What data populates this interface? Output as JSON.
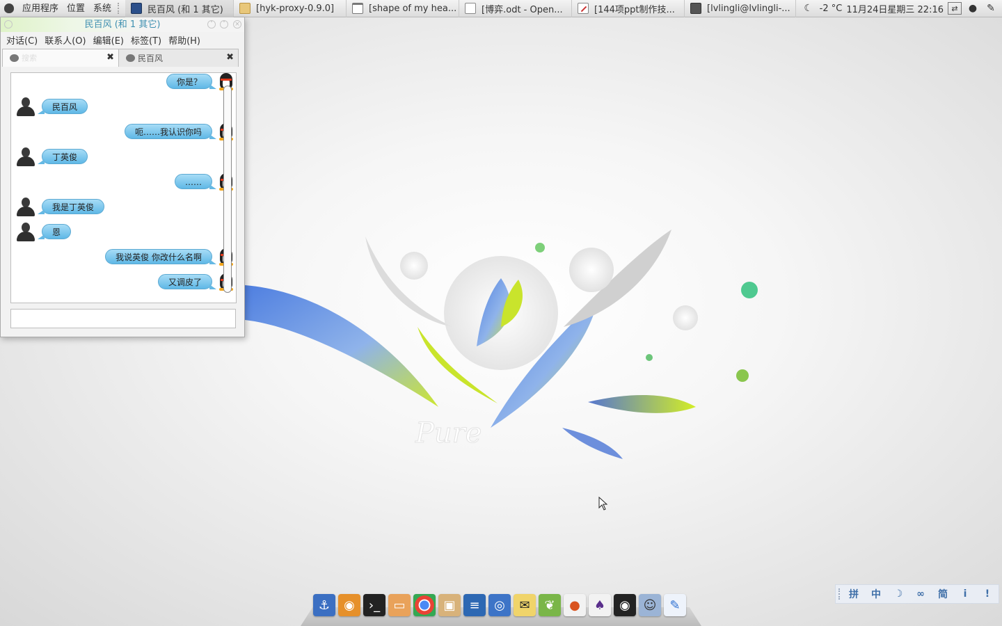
{
  "top_panel": {
    "menus": [
      "应用程序",
      "位置",
      "系统"
    ],
    "tasks": [
      {
        "label": "民百风 (和 1 其它)",
        "icon": "qq-icon",
        "active": true
      },
      {
        "label": "[hyk-proxy-0.9.0]",
        "icon": "folder-icon"
      },
      {
        "label": "[shape of my hea...",
        "icon": "window-icon"
      },
      {
        "label": "[博弈.odt - Open...",
        "icon": "document-icon"
      },
      {
        "label": "[144项ppt制作技...",
        "icon": "pen-icon"
      },
      {
        "label": "[lvlingli@lvlingli-...",
        "icon": "terminal-icon"
      }
    ],
    "weather": "-2 °C",
    "clock": "11月24日星期三 22:16"
  },
  "chat_window": {
    "title": "民百风 (和 1 其它)",
    "menu": [
      "对话(C)",
      "联系人(O)",
      "编辑(E)",
      "标签(T)",
      "帮助(H)"
    ],
    "tabs": [
      {
        "label": "",
        "placeholder": "搜索"
      },
      {
        "label": "民百风"
      }
    ],
    "messages": [
      {
        "dir": "out",
        "text": "你是？"
      },
      {
        "dir": "in",
        "text": "民百风"
      },
      {
        "dir": "out",
        "text": "呃……我认识你吗"
      },
      {
        "dir": "in",
        "text": "丁英俊"
      },
      {
        "dir": "out",
        "text": "……"
      },
      {
        "dir": "in",
        "text": "我是丁英俊"
      },
      {
        "dir": "in",
        "text": "恩"
      },
      {
        "dir": "out",
        "text": "我说英俊 你改什么名啊"
      },
      {
        "dir": "out",
        "text": "又调皮了"
      }
    ],
    "input_value": ""
  },
  "wallpaper": {
    "logo_text": "Pure"
  },
  "dock": {
    "icons": [
      "anchor-icon",
      "camera-icon",
      "terminal-icon",
      "home-folder-icon",
      "chrome-icon",
      "package-installer-icon",
      "spreadsheet-icon",
      "remote-desktop-icon",
      "qq-mail-icon",
      "rabbit-icon",
      "red-panda-icon",
      "wizard-icon",
      "camera-lens-icon",
      "contact-card-icon",
      "pen-edit-icon"
    ]
  },
  "ime": {
    "items": [
      "拼",
      "中",
      "☽",
      "∞",
      "简",
      "i",
      "!"
    ]
  },
  "colors": {
    "accent": "#5fb8e6",
    "title": "#3e8fb0",
    "leaf_green": "#c8e62b",
    "leaf_blue": "#5b86d8"
  }
}
